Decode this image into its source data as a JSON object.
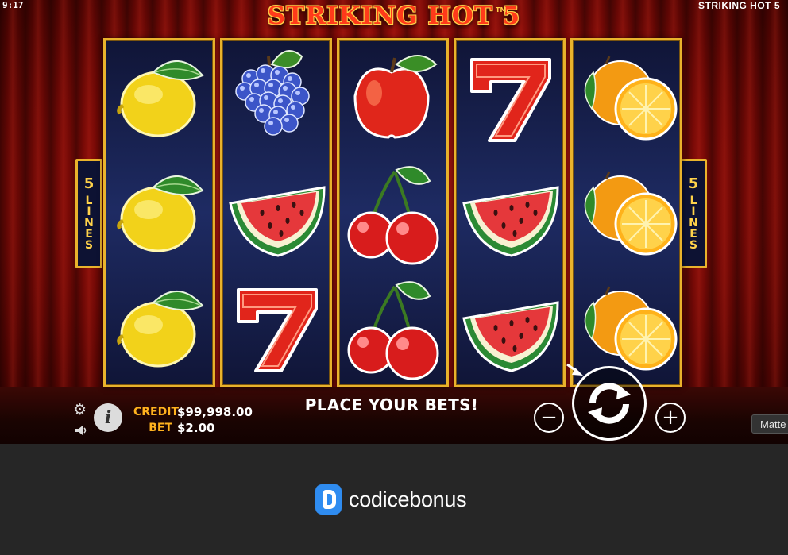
{
  "status": {
    "time": "9:17",
    "game_name": "STRIKING HOT 5"
  },
  "title": {
    "text": "STRIKING HOT 5",
    "trademark": "TM"
  },
  "paylines": {
    "count": "5",
    "word": "LINES"
  },
  "reels": [
    [
      "lemon",
      "lemon",
      "lemon"
    ],
    [
      "grapes",
      "watermelon",
      "seven"
    ],
    [
      "apple",
      "cherries",
      "cherries"
    ],
    [
      "seven",
      "watermelon",
      "watermelon"
    ],
    [
      "orange",
      "orange",
      "orange"
    ]
  ],
  "hud": {
    "credit_label": "CREDIT",
    "credit_value": "$99,998.00",
    "bet_label": "BET",
    "bet_value": "$2.00",
    "message": "PLACE YOUR BETS!",
    "info_label": "i",
    "minus_label": "−",
    "plus_label": "+"
  },
  "icons": {
    "settings": "gear-icon",
    "sound": "speaker-icon",
    "info": "info-icon",
    "spin": "spin-arrows-icon",
    "autoplay": "autoplay-arrow-icon"
  },
  "tooltip": {
    "text": "Matte"
  },
  "brand": {
    "name": "codicebonus"
  },
  "colors": {
    "reel_border": "#e9b32c",
    "curtain": "#a8120c",
    "label_gold": "#ffb21e",
    "brand_blue": "#2f8cf0"
  }
}
